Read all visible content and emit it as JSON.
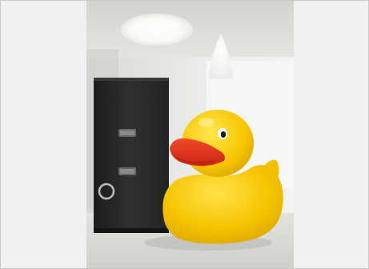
{
  "viewer": {
    "background_color": "#f1f1f1",
    "border_color": "#c9c9c9"
  },
  "photo": {
    "subject_icons": [
      "rubber-duck",
      "black-ring-binder",
      "ceiling-lamp"
    ],
    "colors": {
      "duck_body": "#f6c400",
      "duck_beak": "#e5321b",
      "binder": "#2a2a2a",
      "wall": "#e6e6e4",
      "table": "#dcdcda"
    }
  }
}
